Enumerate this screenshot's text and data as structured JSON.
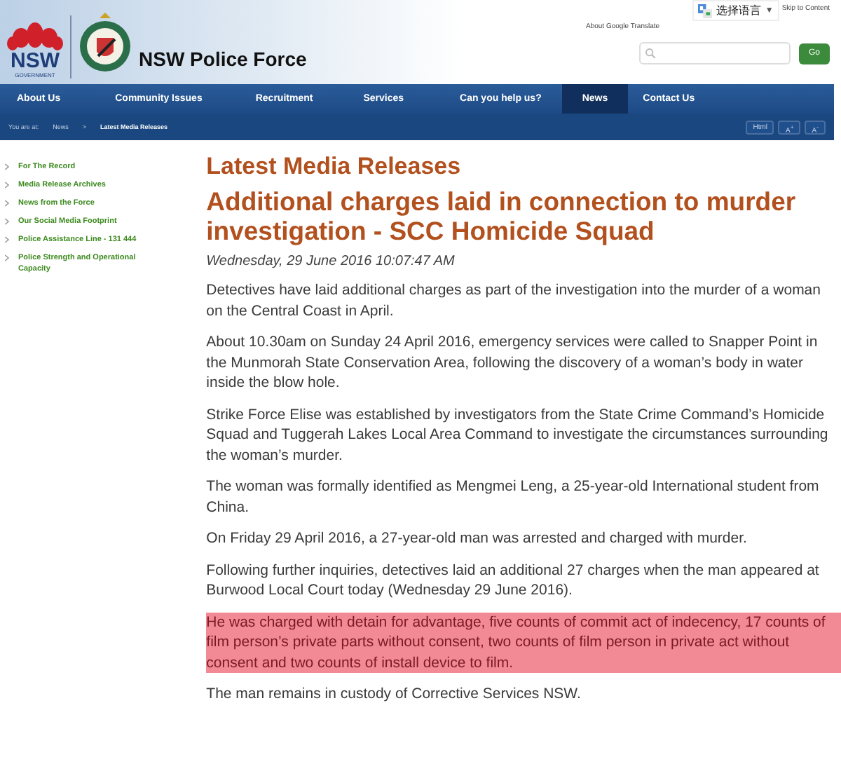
{
  "header": {
    "site_title": "NSW Police Force",
    "logo_text": "NSW",
    "logo_subtext": "GOVERNMENT",
    "translate": {
      "label": "选择语言",
      "caret": "▼",
      "about": "About Google Translate"
    },
    "skip_link": "Skip to Content",
    "go_button": "Go"
  },
  "nav": [
    {
      "label": "About Us",
      "selected": false
    },
    {
      "label": "Community Issues",
      "selected": false
    },
    {
      "label": "Recruitment",
      "selected": false
    },
    {
      "label": "Services",
      "selected": false
    },
    {
      "label": "Can you help us?",
      "selected": false
    },
    {
      "label": "News",
      "selected": true
    },
    {
      "label": "Contact Us",
      "selected": false
    }
  ],
  "breadcrumb": {
    "prefix": "You are at:",
    "items": [
      "News",
      "Latest Media Releases"
    ],
    "separator": ">"
  },
  "text_tools": [
    "Html",
    "A$^{+}$",
    "A$^{-}$"
  ],
  "sidebar": {
    "items": [
      "For The Record",
      "Media Release Archives",
      "News from the Force",
      "Our Social Media Footprint",
      "Police Assistance Line - 131 444",
      "Police Strength and Operational Capacity"
    ]
  },
  "article": {
    "section_title": "Latest Media Releases",
    "headline": "Additional charges laid in connection to murder investigation - SCC Homicide Squad",
    "date": "Wednesday, 29 June 2016 10:07:47 AM",
    "paragraphs": [
      {
        "text": "Detectives have laid additional charges as part of the investigation into the murder of a woman on the Central Coast in April.",
        "highlighted": false
      },
      {
        "text": "About 10.30am on Sunday 24 April 2016, emergency services were called to Snapper Point in the Munmorah State Conservation Area, following the discovery of a woman’s body in water inside the blow hole.",
        "highlighted": false
      },
      {
        "text": "Strike Force Elise was established by investigators from the State Crime Command’s Homicide Squad and Tuggerah Lakes Local Area Command to investigate the circumstances surrounding the woman’s murder.",
        "highlighted": false
      },
      {
        "text": "The woman was formally identified as Mengmei Leng, a 25-year-old International student from China.",
        "highlighted": false
      },
      {
        "text": "On Friday 29 April 2016, a 27-year-old man was arrested and charged with murder.",
        "highlighted": false
      },
      {
        "text": "Following further inquiries, detectives laid an additional 27 charges when the man appeared at Burwood Local Court today (Wednesday 29 June 2016).",
        "highlighted": false
      },
      {
        "text": "He was charged with detain for advantage, five counts of commit act of indecency, 17 counts of film person’s private parts without consent, two counts of film person in private act without consent and two counts of install device to film.",
        "highlighted": true
      },
      {
        "text": "The man remains in custody of Corrective Services NSW.",
        "highlighted": false
      }
    ]
  }
}
